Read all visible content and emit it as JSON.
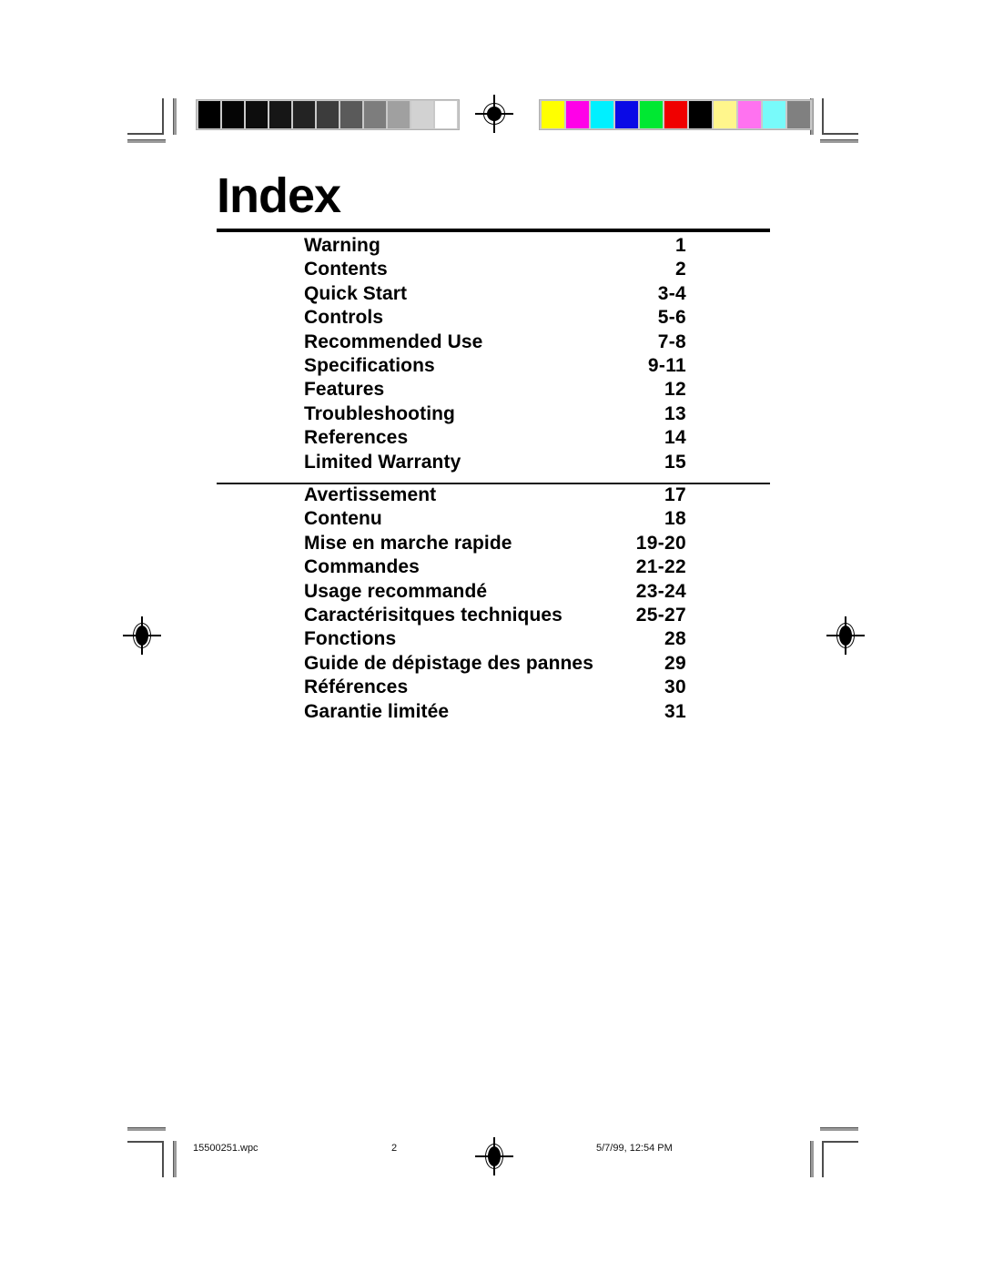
{
  "document": {
    "title": "Index",
    "language_sections": [
      "english",
      "french"
    ]
  },
  "index": {
    "english": [
      {
        "label": "Warning",
        "page": "1"
      },
      {
        "label": "Contents",
        "page": "2"
      },
      {
        "label": "Quick Start",
        "page": "3-4"
      },
      {
        "label": "Controls",
        "page": "5-6"
      },
      {
        "label": "Recommended Use",
        "page": "7-8"
      },
      {
        "label": "Specifications",
        "page": "9-11"
      },
      {
        "label": "Features",
        "page": "12"
      },
      {
        "label": "Troubleshooting",
        "page": "13"
      },
      {
        "label": "References",
        "page": "14"
      },
      {
        "label": "Limited Warranty",
        "page": "15"
      }
    ],
    "french": [
      {
        "label": "Avertissement",
        "page": "17"
      },
      {
        "label": "Contenu",
        "page": "18"
      },
      {
        "label": "Mise en marche rapide",
        "page": "19-20"
      },
      {
        "label": "Commandes",
        "page": "21-22"
      },
      {
        "label": "Usage recommandé",
        "page": "23-24"
      },
      {
        "label": "Caractérisitques techniques",
        "page": "25-27"
      },
      {
        "label": "Fonctions",
        "page": "28"
      },
      {
        "label": "Guide de dépistage des pannes",
        "page": "29"
      },
      {
        "label": "Références",
        "page": "30"
      },
      {
        "label": "Garantie limitée",
        "page": "31"
      }
    ]
  },
  "footer": {
    "file_name": "15500251.wpc",
    "page_number": "2",
    "timestamp": "5/7/99, 12:54 PM"
  },
  "print_marks": {
    "grayscale_bar": {
      "label": "grayscale-calibration-bar",
      "swatches": [
        "#000000",
        "#050505",
        "#0d0d0d",
        "#161616",
        "#232323",
        "#3c3c3c",
        "#5a5a5a",
        "#7d7d7d",
        "#a0a0a0",
        "#d2d2d2",
        "#ffffff"
      ]
    },
    "color_bar": {
      "label": "color-calibration-bar",
      "swatches": [
        "#ffff00",
        "#ff00e8",
        "#00f0ff",
        "#0a0ae6",
        "#00e832",
        "#f00000",
        "#000000",
        "#fff68c",
        "#ff72f0",
        "#78fafa",
        "#808080"
      ]
    },
    "registration_targets": 4,
    "crop_corners": 4
  }
}
